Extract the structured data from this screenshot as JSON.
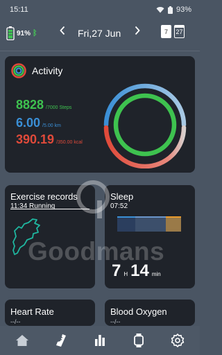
{
  "status": {
    "time": "15:11",
    "battery": "93%"
  },
  "device": {
    "battery": "91%"
  },
  "date_nav": {
    "date": "Fri,27 Jun",
    "calendar_week": "7",
    "calendar_day": "27"
  },
  "activity": {
    "title": "Activity",
    "steps": {
      "value": "8828",
      "goal": "/7000 Steps",
      "color": "#3ec24f"
    },
    "distance": {
      "value": "6.00",
      "goal": "/5.00 km",
      "color": "#3a8fd6"
    },
    "calories": {
      "value": "390.19",
      "goal": "/350.00 kcal",
      "color": "#e04a3a"
    },
    "rings": {
      "steps_progress": 1.26,
      "distance_progress": 1.2,
      "calories_progress": 1.11
    }
  },
  "exercise": {
    "title": "Exercise records",
    "entry": "11:34  Running"
  },
  "sleep": {
    "title": "Sleep",
    "start_time": "07:52",
    "hours": "7",
    "hours_unit": "H",
    "minutes": "14",
    "minutes_unit": "min"
  },
  "heart_rate": {
    "title": "Heart Rate",
    "value": "--/--"
  },
  "blood_oxygen": {
    "title": "Blood Oxygen",
    "value": "--/--"
  },
  "watermark": {
    "text": "Goodmans"
  },
  "bottom_nav": [
    {
      "icon": "home-icon",
      "active": true
    },
    {
      "icon": "running-shoe-icon",
      "active": false
    },
    {
      "icon": "bar-chart-icon",
      "active": false
    },
    {
      "icon": "watch-icon",
      "active": false
    },
    {
      "icon": "gear-icon",
      "active": false
    }
  ]
}
